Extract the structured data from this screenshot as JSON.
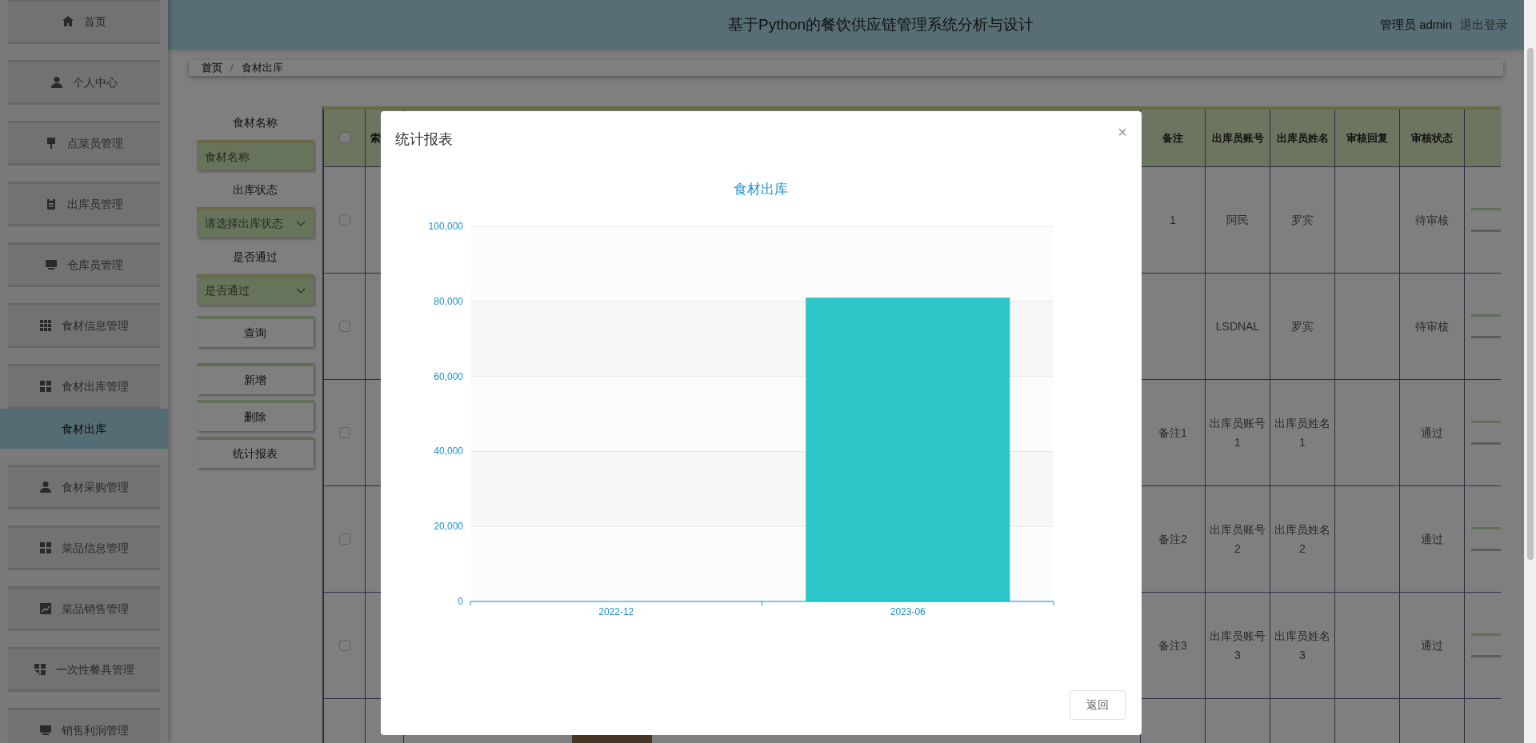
{
  "header": {
    "title": "基于Python的餐饮供应链管理系统分析与设计",
    "user": "管理员 admin",
    "logout": "退出登录"
  },
  "sidebar": {
    "items": [
      {
        "label": "首页"
      },
      {
        "label": "个人中心"
      },
      {
        "label": "点菜员管理"
      },
      {
        "label": "出库员管理"
      },
      {
        "label": "仓库员管理"
      },
      {
        "label": "食材信息管理"
      },
      {
        "label": "食材出库管理",
        "children": [
          {
            "label": "食材出库",
            "selected": true
          }
        ]
      },
      {
        "label": "食材采购管理"
      },
      {
        "label": "菜品信息管理"
      },
      {
        "label": "菜品销售管理"
      },
      {
        "label": "一次性餐具管理"
      },
      {
        "label": "销售利润管理"
      }
    ]
  },
  "breadcrumb": {
    "items": [
      "首页",
      "食材出库"
    ],
    "separator": "/"
  },
  "filters": [
    {
      "kind": "input",
      "label": "食材名称",
      "placeholder": "食材名称"
    },
    {
      "kind": "select",
      "label": "出库状态",
      "placeholder": "请选择出库状态"
    },
    {
      "kind": "select",
      "label": "是否通过",
      "placeholder": "是否通过"
    }
  ],
  "buttons": [
    "查询",
    "新增",
    "删除",
    "统计报表"
  ],
  "table": {
    "header_checked": false,
    "columns": [
      "索",
      "备注",
      "出库员账号",
      "出库员姓名",
      "审核回复",
      "审核状态"
    ],
    "rows": [
      {
        "checked": false,
        "cells": [
          "",
          "1",
          "阿民",
          "罗宾",
          "",
          "待审核"
        ]
      },
      {
        "checked": false,
        "cells": [
          "",
          "",
          "LSDNAL",
          "罗宾",
          "",
          "待审核"
        ]
      },
      {
        "checked": false,
        "cells": [
          "",
          "备注1",
          "出库员账号1",
          "出库员姓名1",
          "",
          "通过"
        ]
      },
      {
        "checked": false,
        "cells": [
          "",
          "备注2",
          "出库员账号2",
          "出库员姓名2",
          "",
          "通过"
        ]
      },
      {
        "checked": false,
        "cells": [
          "",
          "备注3",
          "出库员账号3",
          "出库员姓名3",
          "",
          "通过"
        ]
      }
    ]
  },
  "modal": {
    "title": "统计报表",
    "close": "×",
    "button": "返回",
    "chart_data": {
      "type": "bar",
      "title": "食材出库",
      "categories": [
        "2022-12",
        "2023-06"
      ],
      "values": [
        0,
        81000
      ],
      "ylim": [
        0,
        100000
      ],
      "grid": true,
      "yticks": [
        {
          "value": 0,
          "label": "0"
        },
        {
          "value": 20000,
          "label": "20,000"
        },
        {
          "value": 40000,
          "label": "40,000"
        },
        {
          "value": 60000,
          "label": "60,000"
        },
        {
          "value": 80000,
          "label": "80,000"
        },
        {
          "value": 100000,
          "label": "100,000"
        }
      ]
    }
  }
}
